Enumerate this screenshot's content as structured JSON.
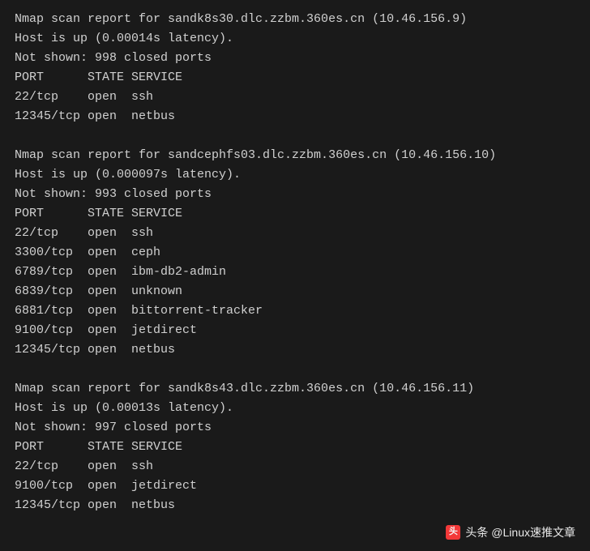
{
  "reports": [
    {
      "header": "Nmap scan report for sandk8s30.dlc.zzbm.360es.cn (10.46.156.9)",
      "host_status": "Host is up (0.00014s latency).",
      "not_shown": "Not shown: 998 closed ports",
      "columns": "PORT      STATE SERVICE",
      "rows": [
        "22/tcp    open  ssh",
        "12345/tcp open  netbus"
      ]
    },
    {
      "header": "Nmap scan report for sandcephfs03.dlc.zzbm.360es.cn (10.46.156.10)",
      "host_status": "Host is up (0.000097s latency).",
      "not_shown": "Not shown: 993 closed ports",
      "columns": "PORT      STATE SERVICE",
      "rows": [
        "22/tcp    open  ssh",
        "3300/tcp  open  ceph",
        "6789/tcp  open  ibm-db2-admin",
        "6839/tcp  open  unknown",
        "6881/tcp  open  bittorrent-tracker",
        "9100/tcp  open  jetdirect",
        "12345/tcp open  netbus"
      ]
    },
    {
      "header": "Nmap scan report for sandk8s43.dlc.zzbm.360es.cn (10.46.156.11)",
      "host_status": "Host is up (0.00013s latency).",
      "not_shown": "Not shown: 997 closed ports",
      "columns": "PORT      STATE SERVICE",
      "rows": [
        "22/tcp    open  ssh",
        "9100/tcp  open  jetdirect",
        "12345/tcp open  netbus"
      ]
    }
  ],
  "watermark": {
    "icon_text": "头",
    "label": "头条 @Linux速推文章"
  }
}
